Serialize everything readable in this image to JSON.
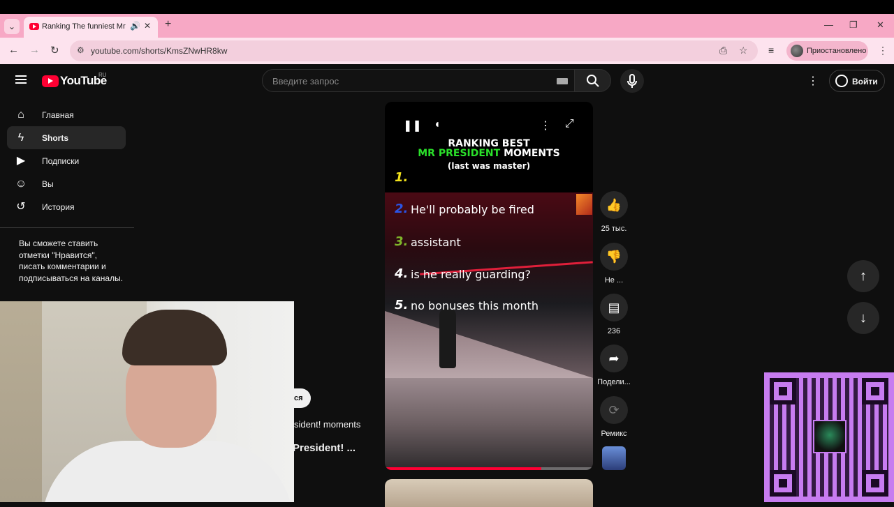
{
  "browser": {
    "tab_title": "Ranking The funniest Mr.Pr",
    "url": "youtube.com/shorts/KmsZNwHR8kw",
    "profile_label": "Приостановлено"
  },
  "youtube": {
    "logo_text": "YouTube",
    "region": "RU",
    "search_placeholder": "Введите запрос",
    "signin_label": "Войти"
  },
  "sidebar": {
    "items": [
      {
        "label": "Главная",
        "icon": "home-icon"
      },
      {
        "label": "Shorts",
        "icon": "shorts-icon"
      },
      {
        "label": "Подписки",
        "icon": "subscriptions-icon"
      },
      {
        "label": "Вы",
        "icon": "you-icon"
      },
      {
        "label": "История",
        "icon": "history-icon"
      }
    ],
    "active": "Shorts",
    "signin_message": "Вы сможете ставить отметки \"Нравится\", писать комментарии и подписываться на каналы."
  },
  "overlay_fragments": {
    "button_fragment": "ся",
    "title_fragment": "sident! moments",
    "title_fragment_bold": "President! ..."
  },
  "short": {
    "title_line1": "RANKING BEST",
    "title_line2_green": "MR PRESIDENT",
    "title_line2_white": "MOMENTS",
    "title_line3": "(last was master)",
    "ranks": [
      {
        "num": "1.",
        "text": "",
        "color": "#f2e21b"
      },
      {
        "num": "2.",
        "text": "He'll probably be fired",
        "color": "#2a55e8"
      },
      {
        "num": "3.",
        "text": "assistant",
        "color": "#7fb52a"
      },
      {
        "num": "4.",
        "text": "is he really guarding?",
        "color": "#ffffff"
      },
      {
        "num": "5.",
        "text": "no bonuses this month",
        "color": "#ffffff"
      }
    ],
    "progress": 0.75
  },
  "actions": {
    "likes": "25 тыс.",
    "dislike": "Не ...",
    "comments": "236",
    "share": "Подели...",
    "remix": "Ремикс"
  }
}
